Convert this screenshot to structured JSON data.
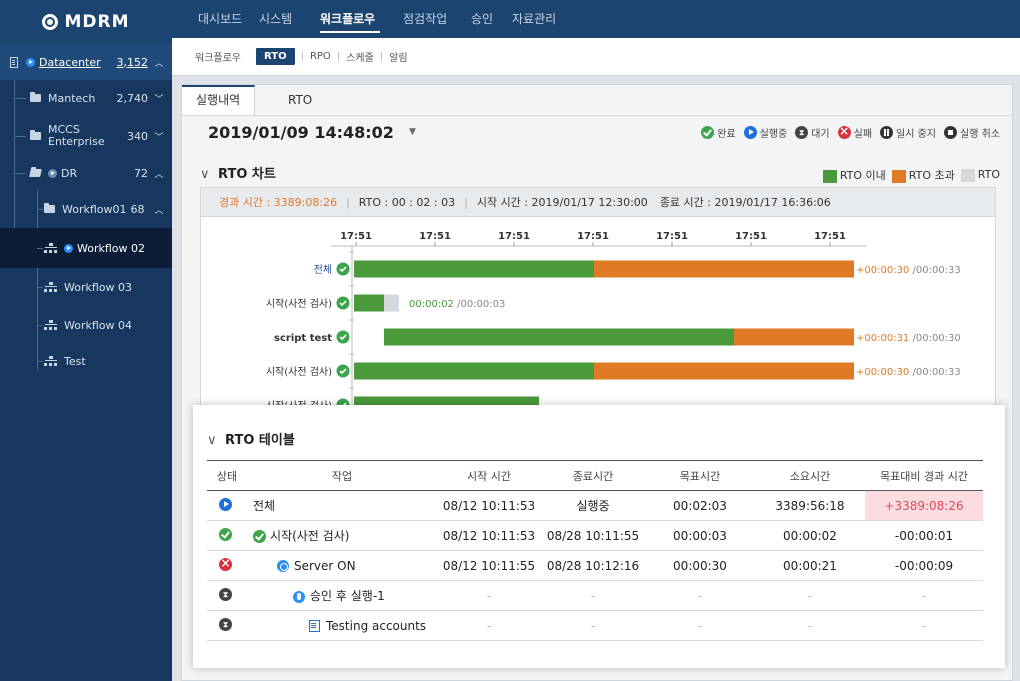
{
  "app": {
    "logo": "MDRM"
  },
  "topnav": {
    "items": [
      {
        "label": "대시보드"
      },
      {
        "label": "시스템"
      },
      {
        "label": "워크플로우",
        "active": true
      },
      {
        "label": "점검작업"
      },
      {
        "label": "승인"
      },
      {
        "label": "자료관리"
      }
    ]
  },
  "subnav": {
    "items": [
      {
        "label": "워크플로우"
      },
      {
        "label": "RTO",
        "active": true
      },
      {
        "label": "RPO"
      },
      {
        "label": "스케줄"
      },
      {
        "label": "알림"
      }
    ]
  },
  "sidebar": {
    "datacenter": {
      "label": "Datacenter",
      "count": "3,152",
      "chevron": "^"
    },
    "items": [
      {
        "label": "Mantech",
        "count": "2,740",
        "chevron": "v"
      },
      {
        "label": "MCCS Enterprise",
        "line1": "MCCS",
        "line2": "Enterprise",
        "count": "340",
        "chevron": "v"
      },
      {
        "label": "DR",
        "count": "72",
        "chevron": "^"
      },
      {
        "label": "Workflow01",
        "count": "68",
        "chevron": "^"
      },
      {
        "label": "Workflow 02",
        "active": true
      },
      {
        "label": "Workflow 03"
      },
      {
        "label": "Workflow 04"
      },
      {
        "label": "Test"
      }
    ]
  },
  "tabs": [
    {
      "label": "실행내역",
      "active": true
    },
    {
      "label": "RTO"
    }
  ],
  "run": {
    "datetime": "2019/01/09 14:48:02",
    "caret": "▼"
  },
  "status_legend": [
    {
      "label": "완료",
      "color": "green"
    },
    {
      "label": "실행중",
      "color": "blue"
    },
    {
      "label": "대기",
      "color": "gray"
    },
    {
      "label": "실패",
      "color": "red"
    },
    {
      "label": "일시 중지",
      "color": "pause"
    },
    {
      "label": "실행 취소",
      "color": "stop"
    }
  ],
  "chart_section": {
    "title": "RTO 차트",
    "chevron": "∨",
    "legend": [
      {
        "label": "RTO 이내",
        "color": "#4a9a3c"
      },
      {
        "label": "RTO 초과",
        "color": "#e07a24"
      },
      {
        "label": "RTO",
        "color": "#d6d9dc"
      }
    ],
    "info": {
      "elapsed": "경과 시간 : 3389:08:26",
      "rto": "RTO : 00 : 02 : 03",
      "start": "시작 시간 : 2019/01/17 12:30:00",
      "end": "종료 시간 : 2019/01/17 16:36:06"
    }
  },
  "chart_data": {
    "type": "bar",
    "orientation": "horizontal",
    "stacked": true,
    "x_ticks": [
      "17:51",
      "17:51",
      "17:51",
      "17:51",
      "17:51",
      "17:51",
      "17:51"
    ],
    "categories": [
      "전체",
      "시작(사전 검사)",
      "script test",
      "시작(사전 검사)",
      "시작(사전 검사)"
    ],
    "series": [
      {
        "name": "RTO 이내",
        "color": "#4a9a3c",
        "start": [
          0,
          0,
          0.06,
          0,
          0
        ],
        "values": [
          0.48,
          0.06,
          0.7,
          0.48,
          0.37
        ]
      },
      {
        "name": "RTO 초과",
        "color": "#e07a24",
        "start": [
          0.48,
          0.06,
          0.76,
          0.48,
          0.37
        ],
        "values": [
          0.52,
          0,
          0.24,
          0.52,
          0
        ]
      },
      {
        "name": "RTO",
        "color": "#d6d9dc",
        "start": [
          1,
          0.06,
          1,
          1,
          0.37
        ],
        "values": [
          0,
          0.03,
          0,
          0,
          0
        ]
      }
    ],
    "data_labels": [
      {
        "main": "+00:00:30",
        "sub": "/00:00:33",
        "color": "#e07a24"
      },
      {
        "main": "00:00:02",
        "sub": "/00:00:03",
        "color": "#4a9a3c"
      },
      {
        "main": "+00:00:31",
        "sub": "/00:00:30",
        "color": "#e07a24"
      },
      {
        "main": "+00:00:30",
        "sub": "/00:00:33",
        "color": "#e07a24"
      },
      {
        "main": "",
        "sub": "",
        "color": "#e07a24"
      }
    ]
  },
  "table_section": {
    "title": "RTO 테이블",
    "chevron": "∨",
    "headers": [
      "상태",
      "작업",
      "시작 시간",
      "종료시간",
      "목표시간",
      "소요시간",
      "목표대비 경과 시간"
    ],
    "rows": [
      {
        "status": "blue",
        "task_icon": "",
        "task": "전체",
        "start": "08/12 10:11:53",
        "end": "실행중",
        "target": "00:02:03",
        "duration": "3389:56:18",
        "diff": "+3389:08:26",
        "over": true
      },
      {
        "status": "green",
        "task_icon": "play",
        "task": "시작(사전 검사)",
        "start": "08/12 10:11:53",
        "end": "08/28 10:11:55",
        "target": "00:00:03",
        "duration": "00:00:02",
        "diff": "-00:00:01"
      },
      {
        "status": "red",
        "task_icon": "power",
        "task": "Server ON",
        "start": "08/12 10:11:55",
        "end": "08/28 10:12:16",
        "target": "00:00:30",
        "duration": "00:00:21",
        "diff": "-00:00:09"
      },
      {
        "status": "gray",
        "task_icon": "hand",
        "task": "승인 후 실행-1",
        "start": "-",
        "end": "-",
        "target": "-",
        "duration": "-",
        "diff": "-"
      },
      {
        "status": "gray",
        "task_icon": "note",
        "task": "Testing accounts",
        "start": "-",
        "end": "-",
        "target": "-",
        "duration": "-",
        "diff": "-"
      }
    ]
  }
}
